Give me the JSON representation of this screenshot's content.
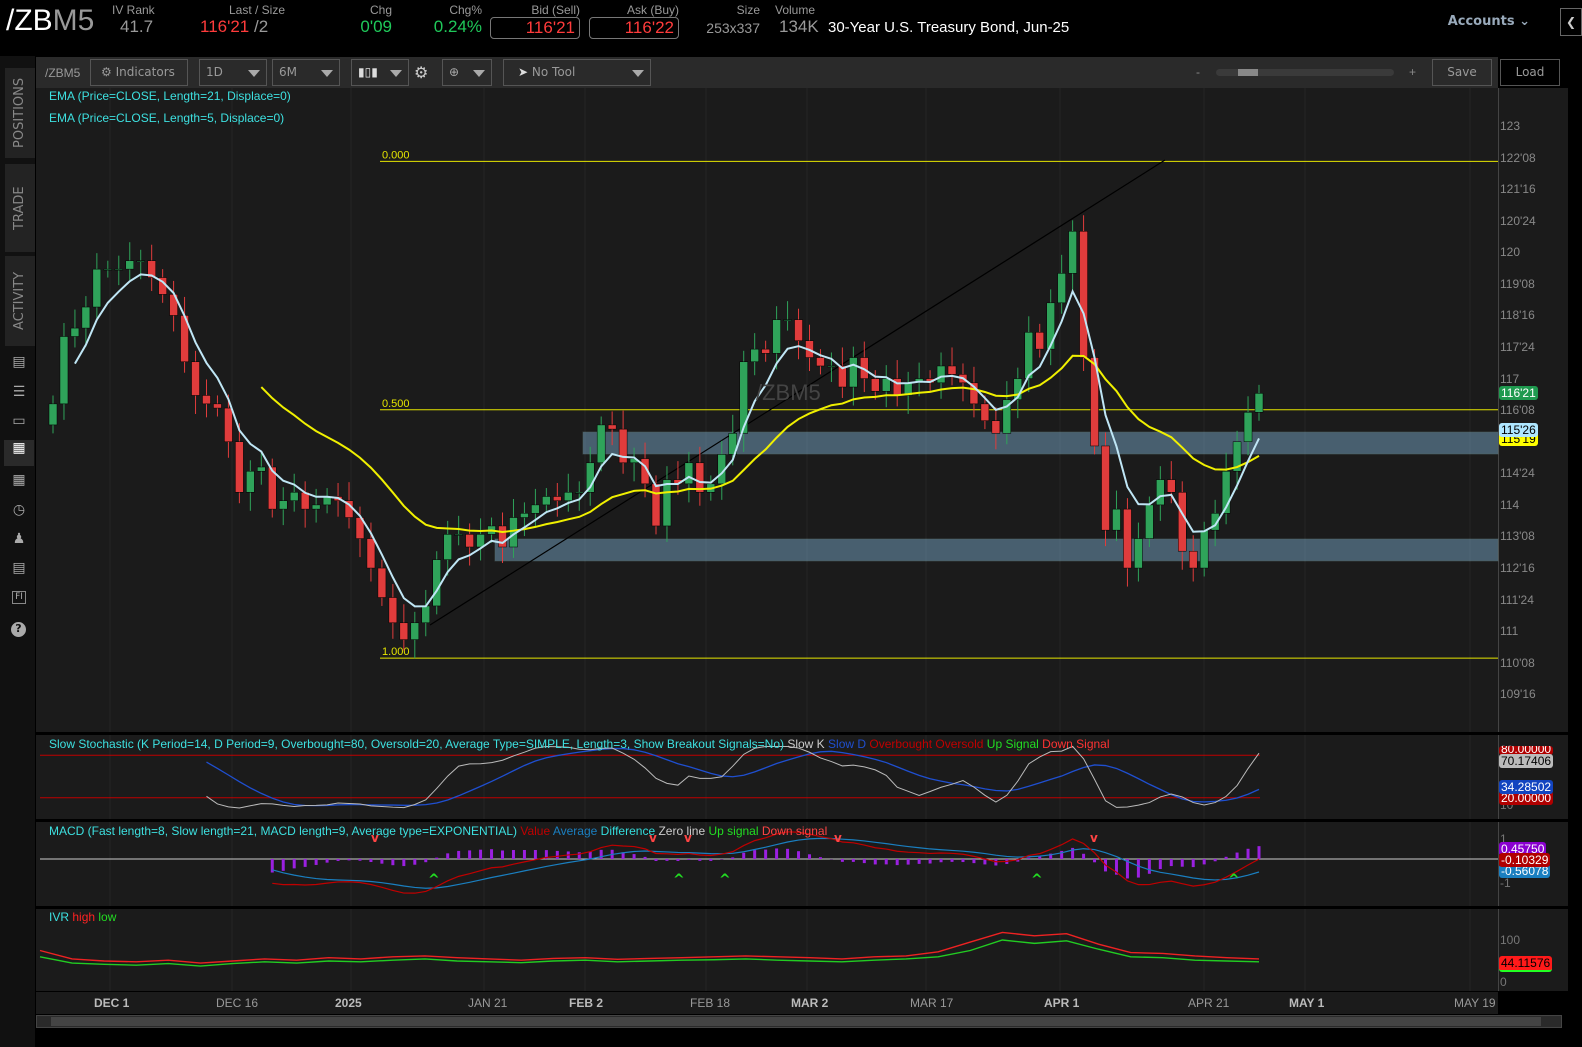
{
  "header": {
    "symbol_a": "/ZB",
    "symbol_b": "M5",
    "iv_rank_label": "IV Rank",
    "iv_rank": "41.7",
    "last_label": "Last / Size",
    "last": "116'21",
    "size_suffix": "/2",
    "chg_label": "Chg",
    "chg": "0'09",
    "chgp_label": "Chg%",
    "chgp": "0.24%",
    "bid_label": "Bid (Sell)",
    "bid": "116'21",
    "ask_label": "Ask (Buy)",
    "ask": "116'22",
    "size_label": "Size",
    "size": "253x337",
    "volume_label": "Volume",
    "volume": "134K",
    "description": "30-Year U.S. Treasury Bond, Jun-25",
    "accounts": "Accounts"
  },
  "sidebar": {
    "tabs": [
      "POSITIONS",
      "TRADE",
      "ACTIVITY"
    ],
    "icons": [
      "chart-bar-icon",
      "list-icon",
      "tv-icon",
      "charts-icon",
      "grid-icon",
      "clock-icon",
      "people-icon",
      "calendar-icon",
      "fi-icon",
      "help-icon"
    ]
  },
  "toolbar": {
    "symbol": "/ZBM5",
    "indicators": "Indicators",
    "aggregation": "1D",
    "range": "6M",
    "tool": "No Tool",
    "zoom_minus": "-",
    "zoom_plus": "+",
    "zoom_level": 0.08,
    "save": "Save",
    "load": "Load"
  },
  "studies": {
    "ema21": "EMA (Price=CLOSE, Length=21, Displace=0)",
    "ema5": "EMA (Price=CLOSE, Length=5, Displace=0)",
    "watermark": "/ZBM5",
    "stoch": "Slow Stochastic (K Period=14, D Period=9, Overbought=80, Oversold=20, Average Type=SIMPLE, Length=3, Show Breakout Signals=No)",
    "stoch_legend": [
      {
        "t": "Slow K",
        "c": "#cccccc"
      },
      {
        "t": "Slow D",
        "c": "#1f4fd0"
      },
      {
        "t": "Overbought",
        "c": "#c00000"
      },
      {
        "t": "Oversold",
        "c": "#c00000"
      },
      {
        "t": "Up Signal",
        "c": "#22dd22"
      },
      {
        "t": "Down Signal",
        "c": "#ff3333"
      }
    ],
    "macd": "MACD (Fast length=8, Slow length=21, MACD length=9, Average type=EXPONENTIAL)",
    "macd_legend": [
      {
        "t": "Value",
        "c": "#c00000"
      },
      {
        "t": "Average",
        "c": "#1a7fc0"
      },
      {
        "t": "Difference",
        "c": "#33dddd"
      },
      {
        "t": "Zero line",
        "c": "#cccccc"
      },
      {
        "t": "Up signal",
        "c": "#22dd22"
      },
      {
        "t": "Down signal",
        "c": "#ff4444"
      }
    ],
    "ivr": "IVR",
    "ivr_legend": [
      {
        "t": "high",
        "c": "#ff2222"
      },
      {
        "t": "low",
        "c": "#22dd22"
      }
    ]
  },
  "tags": {
    "last": "116'21",
    "ema5": "115'26",
    "ema21": "115'19",
    "stoch_ob": "80.00000",
    "stoch_k": "70.17406",
    "stoch_d": "34.28502",
    "stoch_os": "20.00000",
    "macd_diff": "0.45750",
    "macd_val": "-0.10329",
    "macd_avg": "-0.56078",
    "ivr": "44.11576"
  },
  "panel_ticks": {
    "stoch": [
      "80",
      "10"
    ],
    "macd": [
      "1",
      "-1"
    ],
    "ivr": [
      "100",
      "0"
    ]
  },
  "chart_data": {
    "type": "candlestick",
    "symbol": "/ZBM5",
    "aggregation": "1D",
    "closes": [
      116.4,
      118.0,
      118.2,
      118.7,
      119.6,
      119.6,
      119.6,
      119.8,
      119.8,
      119.4,
      119.0,
      118.5,
      117.4,
      116.6,
      116.4,
      116.3,
      115.5,
      114.3,
      114.8,
      114.9,
      113.9,
      114.1,
      114.3,
      113.9,
      114.0,
      114.2,
      114.1,
      113.7,
      113.2,
      112.5,
      111.8,
      111.2,
      110.8,
      111.2,
      111.6,
      112.7,
      113.3,
      113.3,
      113.0,
      113.3,
      113.5,
      113.0,
      113.7,
      113.8,
      114.0,
      114.2,
      114.1,
      114.3,
      114.3,
      115.0,
      115.9,
      115.8,
      115.0,
      115.1,
      114.5,
      113.5,
      114.6,
      114.5,
      115.0,
      114.3,
      114.5,
      115.2,
      115.7,
      117.4,
      117.7,
      117.6,
      118.4,
      118.4,
      117.9,
      117.5,
      117.3,
      117.3,
      116.8,
      117.5,
      117.0,
      116.7,
      117.0,
      116.6,
      116.9,
      117.0,
      116.9,
      117.3,
      117.1,
      116.9,
      116.4,
      116.0,
      115.7,
      116.5,
      117.0,
      118.1,
      117.7,
      118.8,
      119.5,
      120.5,
      117.5,
      115.4,
      113.4,
      113.9,
      112.5,
      113.2,
      114.0,
      114.6,
      114.3,
      112.9,
      112.5,
      113.4,
      113.8,
      114.8,
      115.5,
      116.2,
      116.65
    ],
    "first_open": 115.9,
    "y_range": [
      109.0,
      124.0
    ],
    "y_ticks": [
      {
        "v": 123,
        "t": "123"
      },
      {
        "v": 122.25,
        "t": "122'08"
      },
      {
        "v": 121.5,
        "t": "121'16"
      },
      {
        "v": 120.75,
        "t": "120'24"
      },
      {
        "v": 120,
        "t": "120"
      },
      {
        "v": 119.25,
        "t": "119'08"
      },
      {
        "v": 118.5,
        "t": "118'16"
      },
      {
        "v": 117.75,
        "t": "117'24"
      },
      {
        "v": 117,
        "t": "117"
      },
      {
        "v": 116.25,
        "t": "116'08"
      },
      {
        "v": 114.75,
        "t": "114'24"
      },
      {
        "v": 114,
        "t": "114"
      },
      {
        "v": 113.25,
        "t": "113'08"
      },
      {
        "v": 112.5,
        "t": "112'16"
      },
      {
        "v": 111.75,
        "t": "111'24"
      },
      {
        "v": 111,
        "t": "111"
      },
      {
        "v": 110.25,
        "t": "110'08"
      },
      {
        "v": 109.5,
        "t": "109'16"
      }
    ],
    "x_ticks": [
      {
        "t": "DEC 1",
        "bold": true
      },
      {
        "t": "DEC 16"
      },
      {
        "t": "2025",
        "bold": true
      },
      {
        "t": "JAN 21"
      },
      {
        "t": "FEB 2",
        "bold": true
      },
      {
        "t": "FEB 18"
      },
      {
        "t": "MAR 2",
        "bold": true
      },
      {
        "t": "MAR 17"
      },
      {
        "t": "APR 1",
        "bold": true
      },
      {
        "t": "APR 21"
      },
      {
        "t": "MAY 1",
        "bold": true
      },
      {
        "t": "MAY 19"
      }
    ],
    "fib": {
      "high": 122.16,
      "low": 110.36,
      "levels": [
        {
          "r": 0,
          "t": "0.000"
        },
        {
          "r": 0.5,
          "t": "0.500"
        },
        {
          "r": 1,
          "t": "1.000"
        }
      ]
    },
    "zones": [
      [
        115.21,
        115.73
      ],
      [
        112.67,
        113.19
      ]
    ],
    "ivr_high": [
      75,
      55,
      50,
      48,
      52,
      45,
      50,
      55,
      52,
      58,
      55,
      60,
      62,
      58,
      55,
      52,
      56,
      58,
      54,
      56,
      58,
      60,
      62,
      60,
      58,
      55,
      60,
      62,
      72,
      95,
      118,
      110,
      115,
      90,
      70,
      68,
      62,
      58,
      55
    ],
    "ivr_low": [
      60,
      45,
      42,
      40,
      44,
      38,
      44,
      48,
      45,
      50,
      48,
      52,
      55,
      50,
      48,
      46,
      50,
      52,
      48,
      50,
      52,
      53,
      55,
      52,
      50,
      48,
      52,
      55,
      60,
      75,
      100,
      92,
      98,
      78,
      60,
      58,
      52,
      50,
      48
    ]
  }
}
